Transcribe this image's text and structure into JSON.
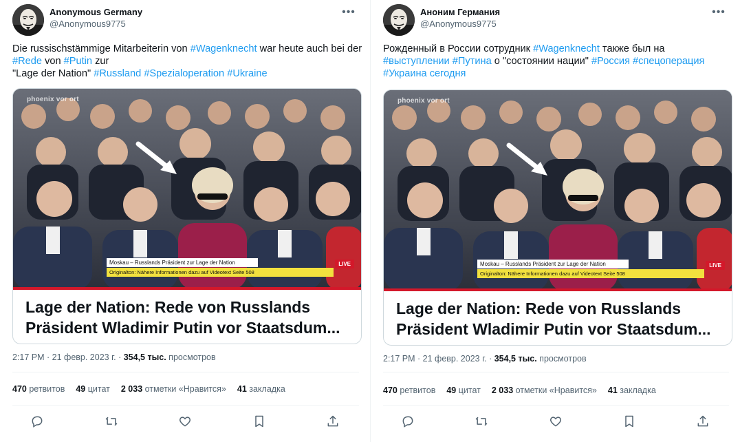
{
  "tweets": [
    {
      "author": {
        "display_name": "Anonymous Germany",
        "handle": "@Anonymous9775"
      },
      "text_parts": [
        {
          "t": "Die russischstämmige Mitarbeiterin von ",
          "tag": false
        },
        {
          "t": "#Wagenknecht",
          "tag": true
        },
        {
          "t": " war heute auch bei der ",
          "tag": false
        },
        {
          "t": "#Rede",
          "tag": true
        },
        {
          "t": " von ",
          "tag": false
        },
        {
          "t": "#Putin",
          "tag": true
        },
        {
          "t": " zur\n\"Lage der Nation\" ",
          "tag": false
        },
        {
          "t": "#Russland",
          "tag": true
        },
        {
          "t": " ",
          "tag": false
        },
        {
          "t": "#Spezialoperation",
          "tag": true
        },
        {
          "t": " ",
          "tag": false
        },
        {
          "t": "#Ukraine",
          "tag": true
        }
      ],
      "card": {
        "watermark": "phoenix vor ort",
        "lower_third_1": "Moskau – Russlands Präsident zur Lage der Nation",
        "lower_third_2": "Originalton: Nähere Informationen dazu auf Videotext Seite 508",
        "live": "LIVE",
        "title_line1": "Lage der Nation: Rede von Russlands",
        "title_line2": "Präsident Wladimir Putin vor Staatsdum..."
      },
      "meta": {
        "time": "2:17 PM · 21 февр. 2023 г. · ",
        "views": "354,5 тыс.",
        "views_label": " просмотров"
      },
      "stats": {
        "retweets": "470",
        "retweets_label": " ретвитов",
        "quotes": "49",
        "quotes_label": " цитат",
        "likes": "2 033",
        "likes_label": " отметки «Нравится»",
        "bookmarks": "41",
        "bookmarks_label": " закладка"
      }
    },
    {
      "author": {
        "display_name": "Аноним Германия",
        "handle": "@Anonymous9775"
      },
      "text_parts": [
        {
          "t": "Рожденный в России сотрудник ",
          "tag": false
        },
        {
          "t": "#Wagenknecht",
          "tag": true
        },
        {
          "t": " также был на\n",
          "tag": false
        },
        {
          "t": "#выступлении",
          "tag": true
        },
        {
          "t": " ",
          "tag": false
        },
        {
          "t": "#Путина",
          "tag": true
        },
        {
          "t": " о \"состоянии нации\" ",
          "tag": false
        },
        {
          "t": "#Россия",
          "tag": true
        },
        {
          "t": " ",
          "tag": false
        },
        {
          "t": "#спецоперация",
          "tag": true
        },
        {
          "t": "\n",
          "tag": false
        },
        {
          "t": "#Украина сегодня",
          "tag": true
        }
      ],
      "card": {
        "watermark": "phoenix vor ort",
        "lower_third_1": "Moskau – Russlands Präsident zur Lage der Nation",
        "lower_third_2": "Originalton: Nähere Informationen dazu auf Videotext Seite 508",
        "live": "LIVE",
        "title_line1": "Lage der Nation: Rede von Russlands",
        "title_line2": "Präsident Wladimir Putin vor Staatsdum..."
      },
      "meta": {
        "time": "2:17 PM · 21 февр. 2023 г. · ",
        "views": "354,5 тыс.",
        "views_label": " просмотров"
      },
      "stats": {
        "retweets": "470",
        "retweets_label": " ретвитов",
        "quotes": "49",
        "quotes_label": " цитат",
        "likes": "2 033",
        "likes_label": " отметки «Нравится»",
        "bookmarks": "41",
        "bookmarks_label": " закладка"
      }
    }
  ],
  "icons": {
    "more": "more-horizontal-icon",
    "reply": "reply-icon",
    "retweet": "retweet-icon",
    "like": "heart-icon",
    "bookmark": "bookmark-icon",
    "share": "share-icon"
  },
  "colors": {
    "accent": "#1d9bf0",
    "text": "#0f1419",
    "secondary": "#536471",
    "live": "#d3182a",
    "lower_third": "#f2e13e"
  }
}
